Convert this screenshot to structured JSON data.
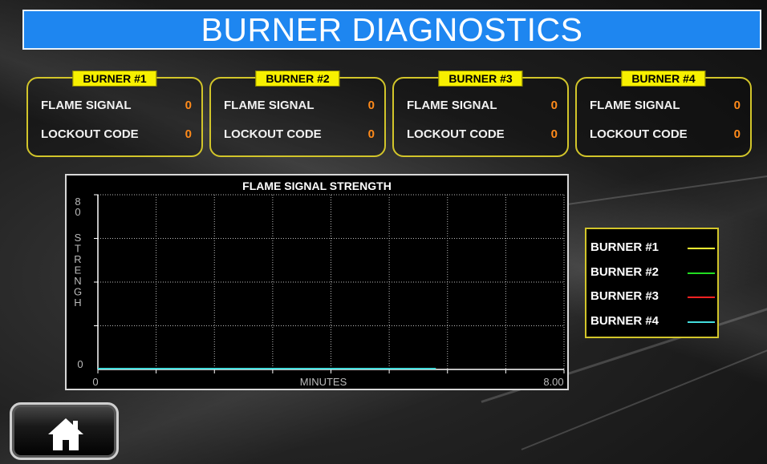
{
  "title": "BURNER DIAGNOSTICS",
  "burners": [
    {
      "name": "BURNER #1",
      "flame_label": "FLAME SIGNAL",
      "flame_value": "0",
      "lockout_label": "LOCKOUT CODE",
      "lockout_value": "0"
    },
    {
      "name": "BURNER #2",
      "flame_label": "FLAME SIGNAL",
      "flame_value": "0",
      "lockout_label": "LOCKOUT CODE",
      "lockout_value": "0"
    },
    {
      "name": "BURNER #3",
      "flame_label": "FLAME SIGNAL",
      "flame_value": "0",
      "lockout_label": "LOCKOUT CODE",
      "lockout_value": "0"
    },
    {
      "name": "BURNER #4",
      "flame_label": "FLAME SIGNAL",
      "flame_value": "0",
      "lockout_label": "LOCKOUT CODE",
      "lockout_value": "0"
    }
  ],
  "legend": [
    {
      "label": "BURNER #1",
      "color": "#ffff33"
    },
    {
      "label": "BURNER #2",
      "color": "#22dd22"
    },
    {
      "label": "BURNER #3",
      "color": "#ff2222"
    },
    {
      "label": "BURNER #4",
      "color": "#44dddd"
    }
  ],
  "chart_data": {
    "type": "line",
    "title": "FLAME SIGNAL STRENGTH",
    "xlabel": "MINUTES",
    "ylabel": "STRENGH",
    "ylabel_top": "80",
    "ylim": [
      0,
      80
    ],
    "xlim": [
      0,
      8.0
    ],
    "x_tick_labels": [
      "0",
      "8.00"
    ],
    "y_tick_labels": [
      "0"
    ],
    "grid": true,
    "series": [
      {
        "name": "BURNER #1",
        "color": "#ffff33",
        "x": [
          0,
          5.8
        ],
        "y": [
          0,
          0
        ]
      },
      {
        "name": "BURNER #2",
        "color": "#22dd22",
        "x": [
          0,
          5.8
        ],
        "y": [
          0,
          0
        ]
      },
      {
        "name": "BURNER #3",
        "color": "#ff2222",
        "x": [
          0,
          5.8
        ],
        "y": [
          0,
          0
        ]
      },
      {
        "name": "BURNER #4",
        "color": "#44dddd",
        "x": [
          0,
          5.8
        ],
        "y": [
          0,
          0
        ]
      }
    ]
  },
  "home_button": {
    "icon": "home-icon"
  }
}
